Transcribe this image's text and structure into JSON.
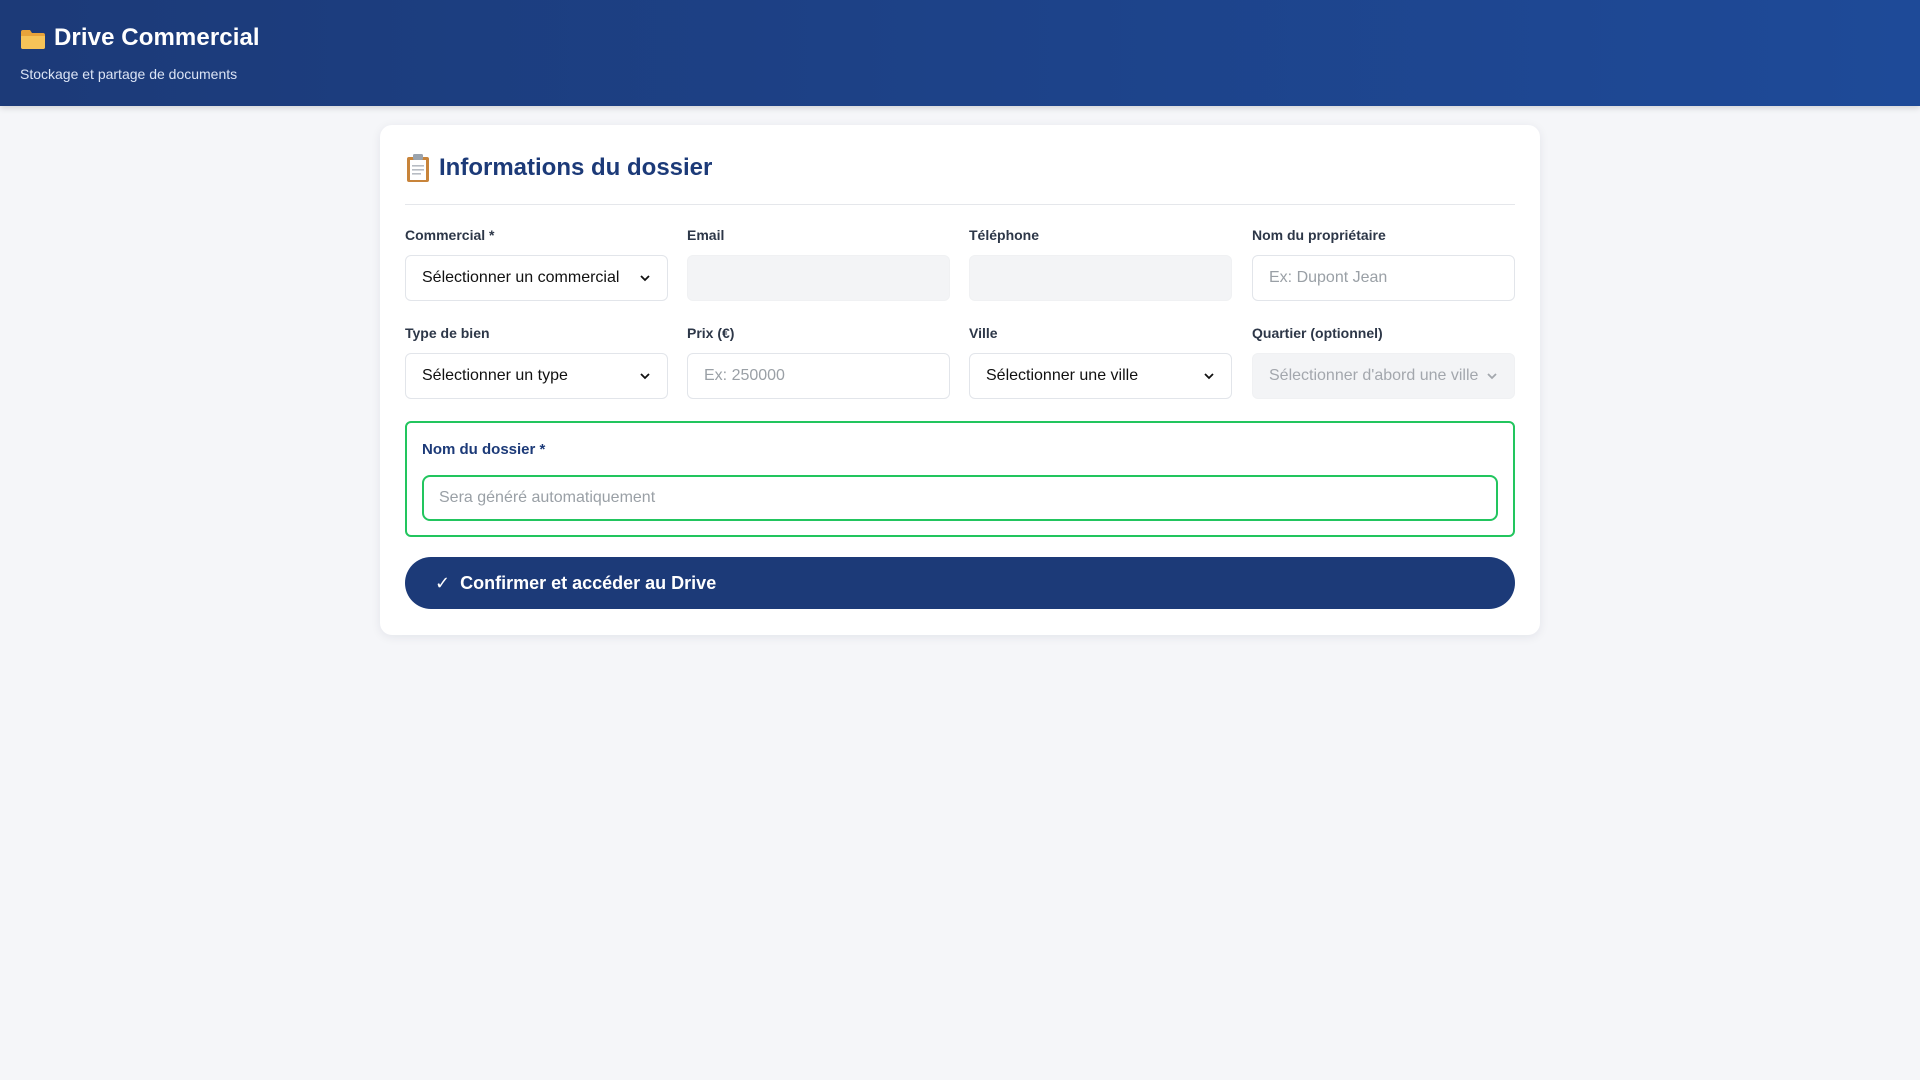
{
  "header": {
    "title": "Drive Commercial",
    "subtitle": "Stockage et partage de documents",
    "icon": "folder-icon"
  },
  "card": {
    "title": "Informations du dossier",
    "icon": "clipboard-icon"
  },
  "fields": {
    "commercial": {
      "label": "Commercial *",
      "value": "Sélectionner un commercial"
    },
    "email": {
      "label": "Email",
      "value": ""
    },
    "telephone": {
      "label": "Téléphone",
      "value": ""
    },
    "proprietaire": {
      "label": "Nom du propriétaire",
      "placeholder": "Ex: Dupont Jean"
    },
    "type_bien": {
      "label": "Type de bien",
      "value": "Sélectionner un type"
    },
    "prix": {
      "label": "Prix (€)",
      "placeholder": "Ex: 250000"
    },
    "ville": {
      "label": "Ville",
      "value": "Sélectionner une ville"
    },
    "quartier": {
      "label": "Quartier (optionnel)",
      "value": "Sélectionner d'abord une ville"
    }
  },
  "dossier": {
    "label": "Nom du dossier *",
    "placeholder": "Sera généré automatiquement"
  },
  "confirm": {
    "check": "✓",
    "label": "Confirmer et accéder au Drive"
  },
  "colors": {
    "header_bg": "#1c3a78",
    "accent_green": "#22c55e",
    "button_bg": "#1c3a78",
    "page_bg": "#f5f6f9"
  }
}
